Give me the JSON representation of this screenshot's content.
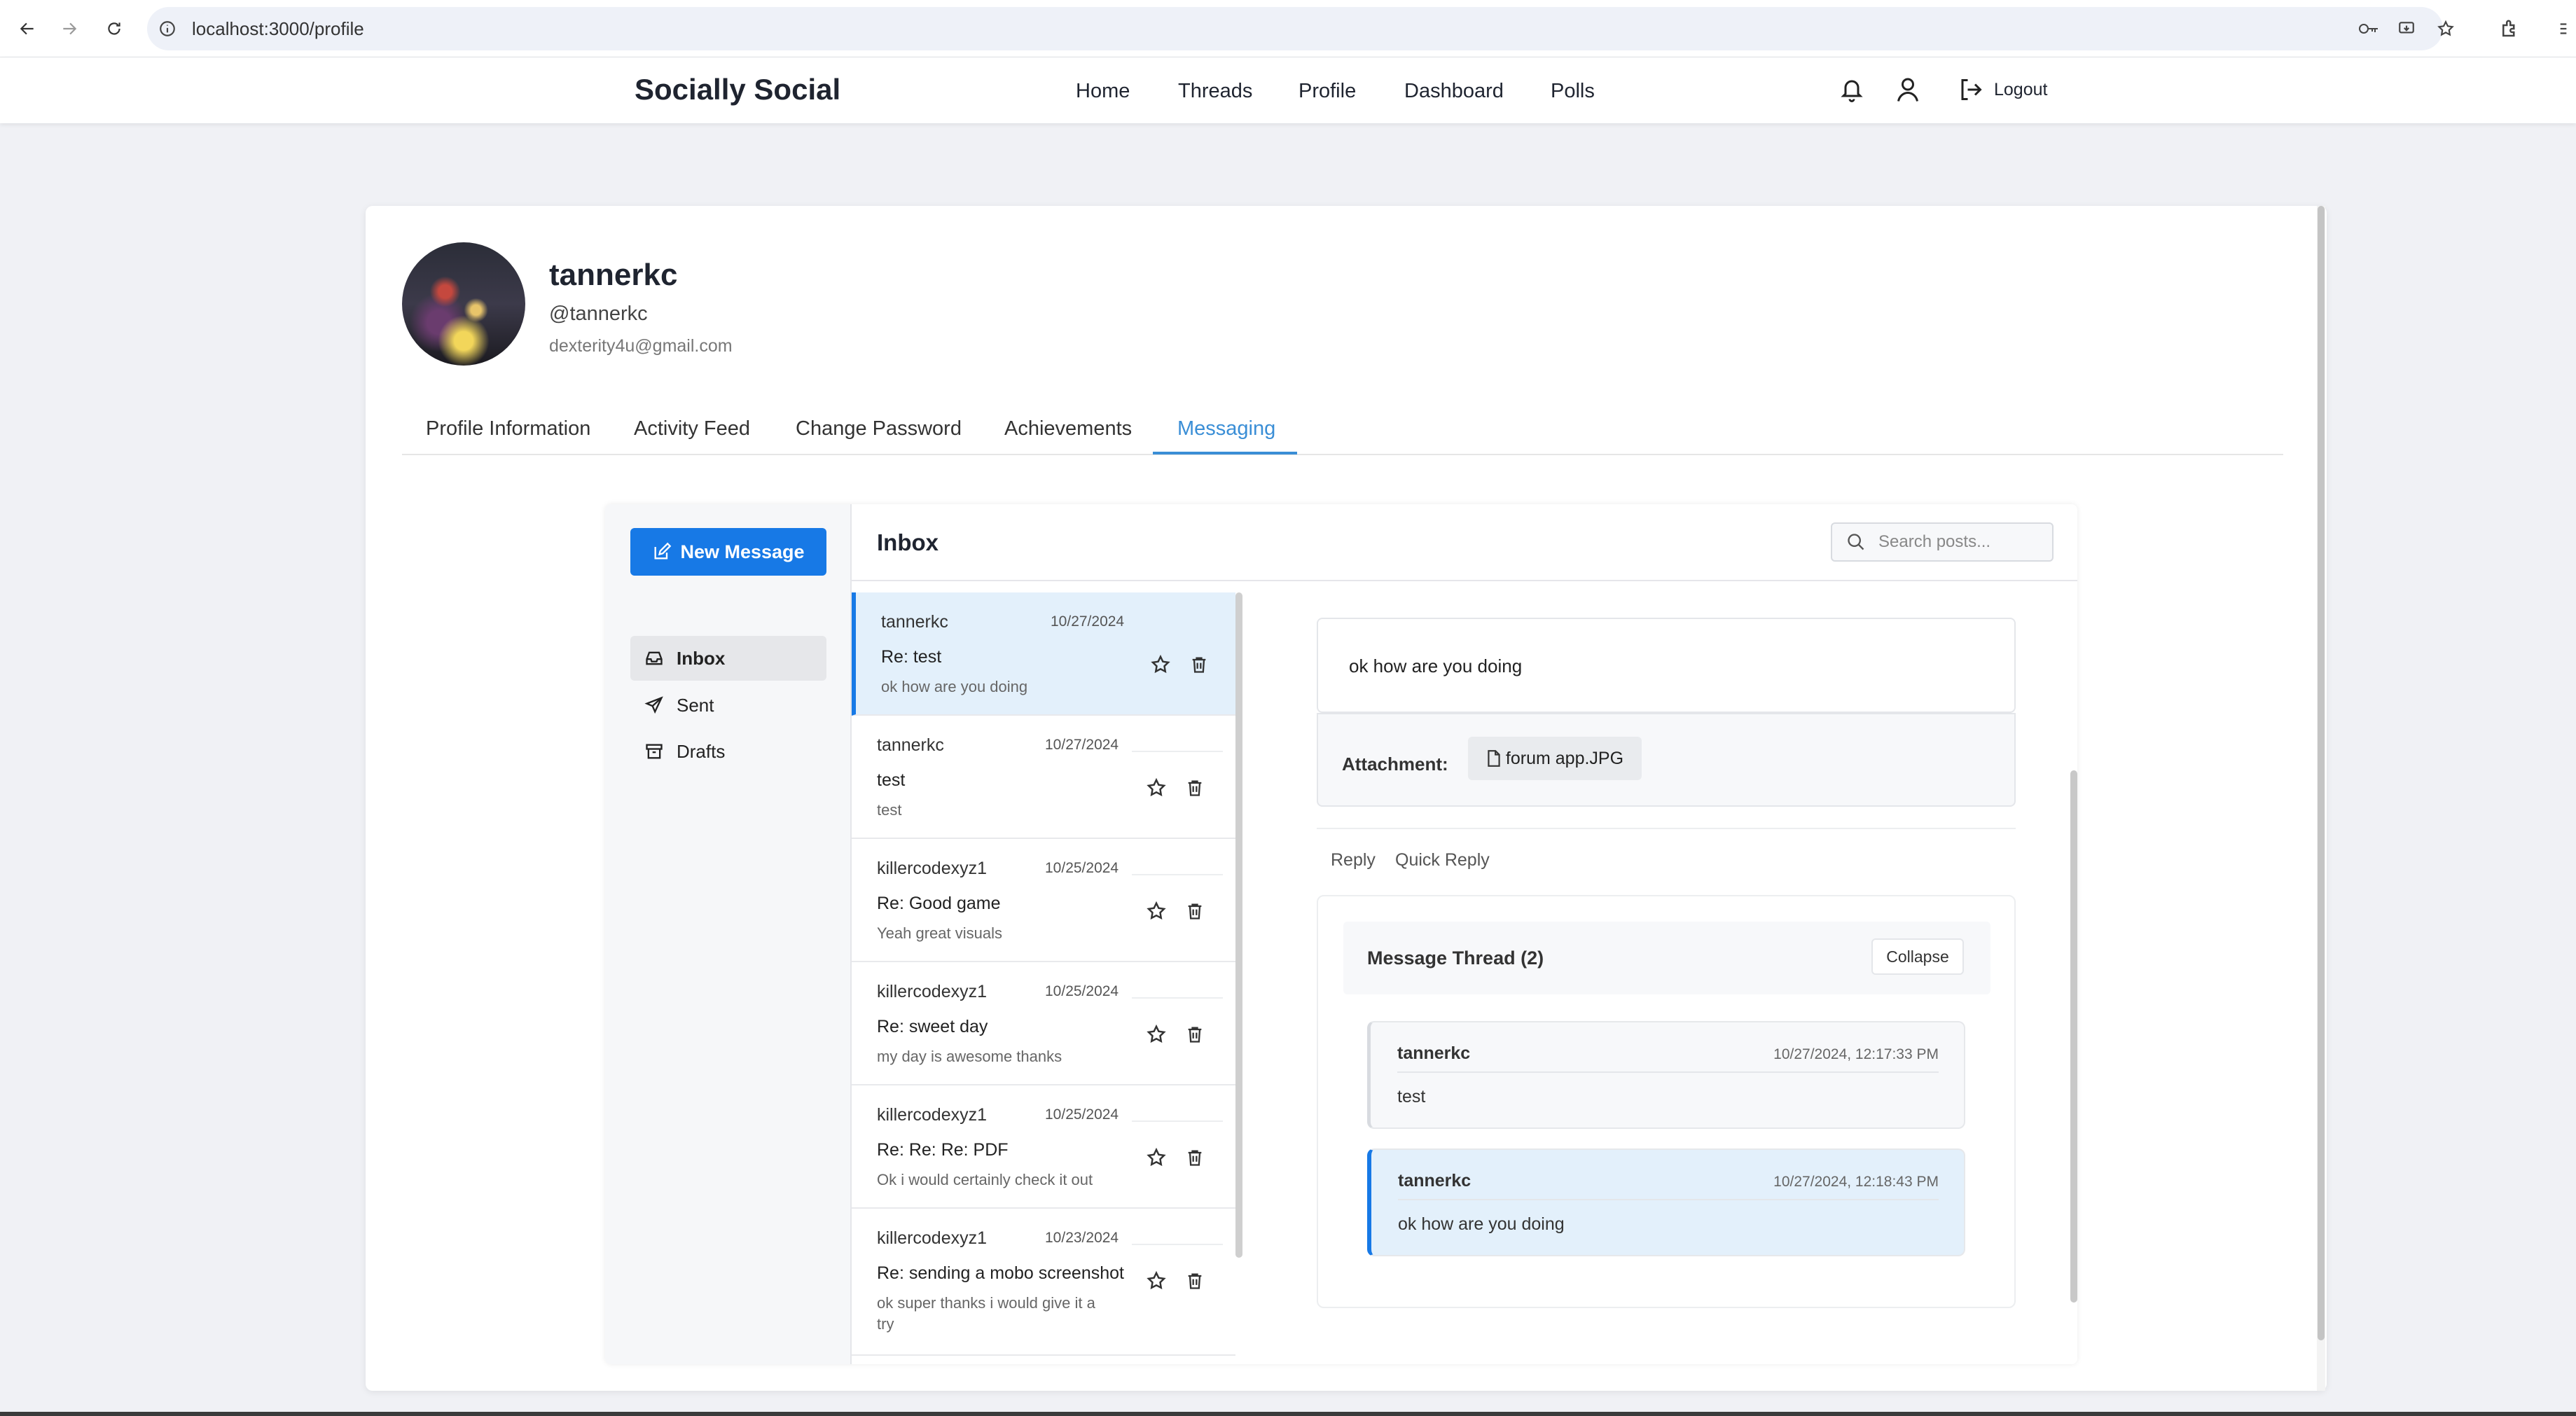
{
  "browser": {
    "url": "localhost:3000/profile"
  },
  "navbar": {
    "brand": "Socially Social",
    "links": [
      "Home",
      "Threads",
      "Profile",
      "Dashboard",
      "Polls"
    ],
    "logout": "Logout"
  },
  "profile": {
    "name": "tannerkc",
    "handle": "@tannerkc",
    "email": "dexterity4u@gmail.com"
  },
  "tabs": [
    "Profile Information",
    "Activity Feed",
    "Change Password",
    "Achievements",
    "Messaging"
  ],
  "active_tab": "Messaging",
  "messaging": {
    "new_message": "New Message",
    "folders": [
      "Inbox",
      "Sent",
      "Drafts"
    ],
    "active_folder": "Inbox",
    "list_title": "Inbox",
    "search_placeholder": "Search posts...",
    "messages": [
      {
        "sender": "tannerkc",
        "date": "10/27/2024",
        "subject": "Re: test",
        "preview": "ok how are you doing"
      },
      {
        "sender": "tannerkc",
        "date": "10/27/2024",
        "subject": "test",
        "preview": "test"
      },
      {
        "sender": "killercodexyz1",
        "date": "10/25/2024",
        "subject": "Re: Good game",
        "preview": "Yeah great visuals"
      },
      {
        "sender": "killercodexyz1",
        "date": "10/25/2024",
        "subject": "Re: sweet day",
        "preview": "my day is awesome thanks"
      },
      {
        "sender": "killercodexyz1",
        "date": "10/25/2024",
        "subject": "Re: Re: Re: PDF",
        "preview": "Ok i would certainly check it out"
      },
      {
        "sender": "killercodexyz1",
        "date": "10/23/2024",
        "subject": "Re: sending a mobo screenshot",
        "preview": "ok super thanks i would give it a try"
      }
    ],
    "detail": {
      "body": "ok how are you doing",
      "attachment_label": "Attachment:",
      "attachment_name": "forum app.JPG",
      "reply": "Reply",
      "quick_reply": "Quick Reply",
      "thread_title": "Message Thread (2)",
      "collapse": "Collapse",
      "thread": [
        {
          "author": "tannerkc",
          "time": "10/27/2024, 12:17:33 PM",
          "body": "test"
        },
        {
          "author": "tannerkc",
          "time": "10/27/2024, 12:18:43 PM",
          "body": "ok how are you doing"
        }
      ]
    }
  },
  "colors": {
    "accent": "#1779e6",
    "tab_active": "#3a8ed6",
    "selected_bg": "#e3f0fb"
  }
}
